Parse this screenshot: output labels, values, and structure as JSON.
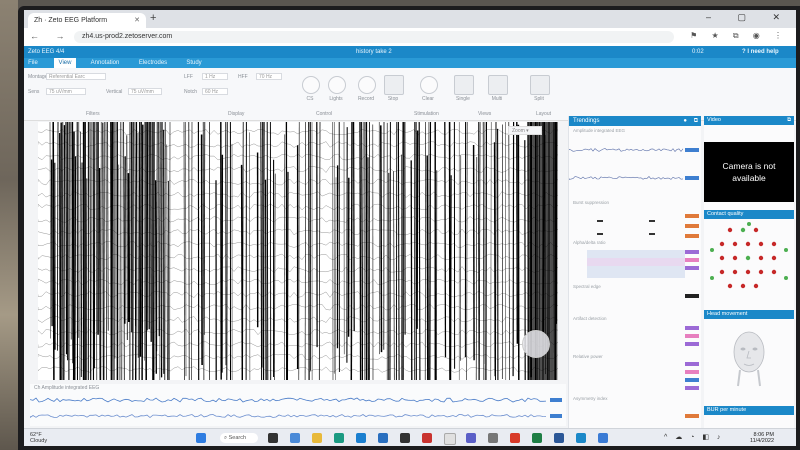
{
  "browser": {
    "tab_title": "Zh · Zeto EEG Platform",
    "url": "zh4.us-prod2.zetoserver.com",
    "new_tab": "+",
    "window_controls": "–  ▢  ✕",
    "nav": "←  →  ⟳"
  },
  "app": {
    "header_left": "Zeto EEG 4/4",
    "header_title": "history take 2",
    "header_status": "0:02",
    "help": "I need help",
    "menu": [
      "File",
      "View",
      "Annotation",
      "Electrodes",
      "Study"
    ],
    "active_menu": "View",
    "toolbar": {
      "montage_label": "Montage",
      "montage_value": "Referential Earc",
      "sensitivity_label": "Sens",
      "sensitivity_value": "75 uV/mm",
      "vertical_label": "Vertical",
      "vertical_value": "75 uV/mm",
      "lff_label": "LFF",
      "lff_value": "1 Hz",
      "hff_label": "HFF",
      "hff_value": "70 Hz",
      "notch_label": "Notch",
      "notch_value": "60 Hz",
      "buttons": [
        "CS",
        "Lights",
        "Record",
        "Stop",
        "Clear",
        "Single",
        "Multi",
        "Split"
      ],
      "group_labels": [
        "Filters",
        "Display",
        "Control",
        "Stimulation",
        "Views",
        "Layout"
      ]
    }
  },
  "eeg": {
    "overlay_label": "Zoom"
  },
  "trend": {
    "title": "Ch  Amplitude integrated EEG"
  },
  "trendings": {
    "title": "Trendings",
    "sections": [
      "Amplitude integrated EEG",
      "Burst suppression",
      "Alpha/delta ratio",
      "Spectral edge",
      "Artifact detection",
      "Relative power",
      "Asymmetry index"
    ],
    "colors": {
      "blue": "#3e7fd0",
      "orange": "#e07a3a",
      "purple": "#9c6ad6",
      "pink": "#e77fbf",
      "gray": "#7b7f86"
    }
  },
  "right_panel": {
    "video_title": "Video",
    "camera_text_1": "Camera is not",
    "camera_text_2": "available",
    "contact_quality": "Contact quality",
    "head_movement": "Head movement",
    "bur_title": "BUR per minute"
  },
  "taskbar": {
    "weather_temp": "62°F",
    "weather_desc": "Cloudy",
    "search": "Search",
    "time": "8:06 PM",
    "date": "11/4/2022"
  }
}
